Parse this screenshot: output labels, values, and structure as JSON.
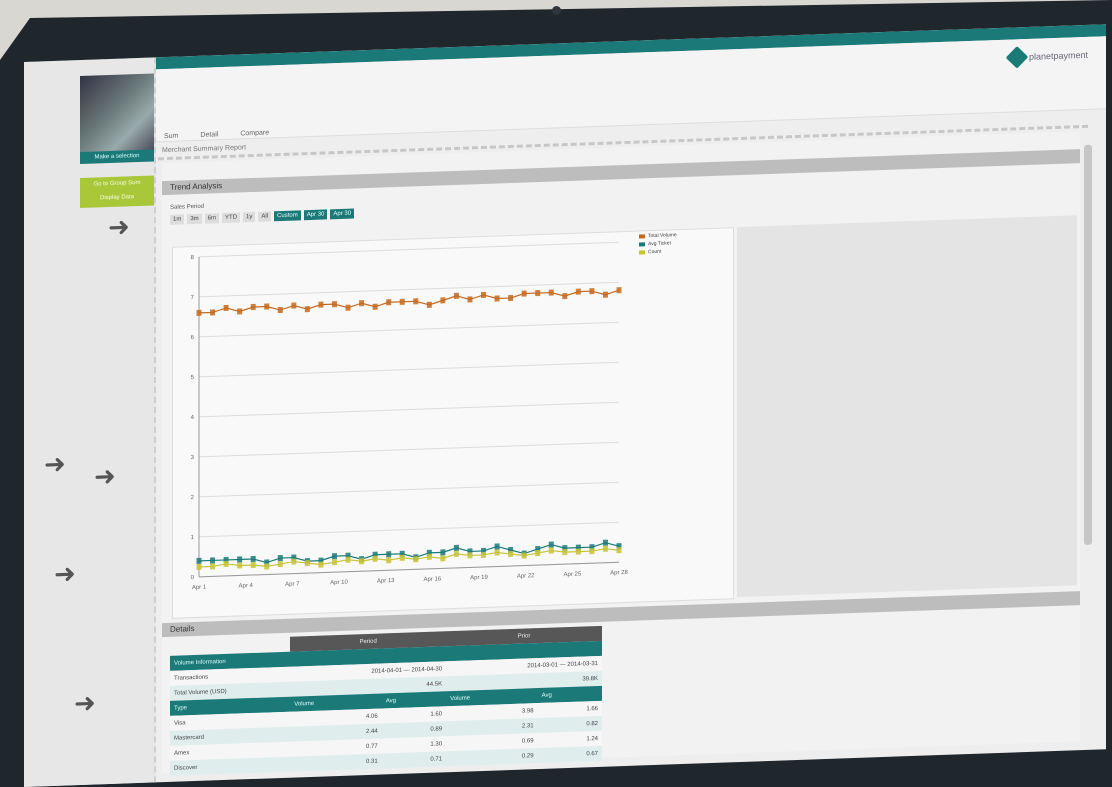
{
  "brand": {
    "name": "planetpayment"
  },
  "sidebar": {
    "hero_label": "Make a selection",
    "green_button": [
      "Go to Group Sum",
      "Display Data"
    ],
    "nav_icons": [
      "arrow-right-icon",
      "arrow-right-icon",
      "arrow-right-icon",
      "arrow-right-icon",
      "arrow-right-icon"
    ]
  },
  "menu": {
    "items": [
      "Sum",
      "Detail",
      "Compare"
    ],
    "breadcrumb": "Merchant Summary Report"
  },
  "chart_section": {
    "title": "Trend Analysis",
    "period_label": "Sales Period",
    "filters": [
      "1m",
      "3m",
      "6m",
      "YTD",
      "1y",
      "All"
    ],
    "teal_filters": [
      "Custom",
      "Apr 30",
      "Apr 30"
    ]
  },
  "chart_data": {
    "type": "line",
    "title": "",
    "xlabel": "",
    "ylabel": "",
    "ylim": [
      0,
      8
    ],
    "legend_placement": "top-right",
    "series": [
      {
        "name": "Total Volume",
        "color": "#c46a1e",
        "values": [
          6.6,
          6.6,
          6.7,
          6.6,
          6.7,
          6.7,
          6.6,
          6.7,
          6.6,
          6.7,
          6.7,
          6.6,
          6.7,
          6.6,
          6.7,
          6.7,
          6.7,
          6.6,
          6.7,
          6.8,
          6.7,
          6.8,
          6.7,
          6.7,
          6.8,
          6.8,
          6.8,
          6.7,
          6.8,
          6.8,
          6.7,
          6.8
        ]
      },
      {
        "name": "Avg Ticket",
        "color": "#1b7a78",
        "values": [
          0.4,
          0.4,
          0.4,
          0.4,
          0.4,
          0.3,
          0.4,
          0.4,
          0.3,
          0.3,
          0.4,
          0.4,
          0.3,
          0.4,
          0.4,
          0.4,
          0.3,
          0.4,
          0.4,
          0.5,
          0.4,
          0.4,
          0.5,
          0.4,
          0.3,
          0.4,
          0.5,
          0.4,
          0.4,
          0.4,
          0.5,
          0.4
        ]
      },
      {
        "name": "Count",
        "color": "#c8c43a",
        "values": [
          0.25,
          0.25,
          0.3,
          0.25,
          0.25,
          0.2,
          0.25,
          0.3,
          0.25,
          0.2,
          0.25,
          0.3,
          0.25,
          0.3,
          0.25,
          0.3,
          0.25,
          0.3,
          0.25,
          0.35,
          0.3,
          0.3,
          0.35,
          0.3,
          0.25,
          0.3,
          0.35,
          0.3,
          0.3,
          0.3,
          0.35,
          0.3
        ]
      }
    ],
    "x_ticks": [
      "Apr 1",
      "Apr 4",
      "Apr 7",
      "Apr 10",
      "Apr 13",
      "Apr 16",
      "Apr 19",
      "Apr 22",
      "Apr 25",
      "Apr 28"
    ],
    "y_ticks": [
      "0",
      "1",
      "2",
      "3",
      "4",
      "5",
      "6",
      "7",
      "8"
    ]
  },
  "table_section": {
    "title": "Details",
    "col_headers": [
      "Period",
      "Prior"
    ],
    "group_header": "Volume Information",
    "rows_top": [
      {
        "label": "Transactions",
        "a": "2014-04-01 — 2014-04-30",
        "b": "2014-03-01 — 2014-03-31"
      },
      {
        "label": "Total Volume (USD)",
        "a": "44.5K",
        "b": "39.8K"
      }
    ],
    "sub_headers": [
      "Type",
      "Volume",
      "Avg",
      "Volume",
      "Avg"
    ],
    "rows": [
      {
        "label": "Visa",
        "v1": "4.06",
        "v2": "1.60",
        "v3": "3.98",
        "v4": "1.66"
      },
      {
        "label": "Mastercard",
        "v1": "2.44",
        "v2": "0.89",
        "v3": "2.31",
        "v4": "0.82"
      },
      {
        "label": "Amex",
        "v1": "0.77",
        "v2": "1.30",
        "v3": "0.69",
        "v4": "1.24"
      },
      {
        "label": "Discover",
        "v1": "0.31",
        "v2": "0.71",
        "v3": "0.29",
        "v4": "0.67"
      }
    ]
  }
}
